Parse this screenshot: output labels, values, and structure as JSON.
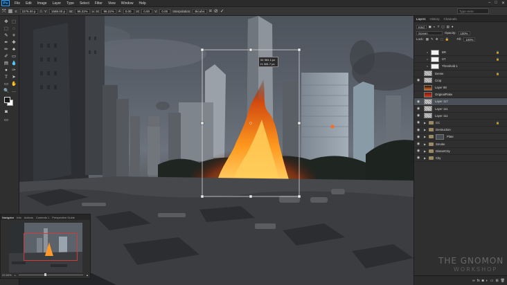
{
  "app": {
    "logo": "Ps"
  },
  "menu": [
    "File",
    "Edit",
    "Image",
    "Layer",
    "Type",
    "Select",
    "Filter",
    "View",
    "Window",
    "Help"
  ],
  "window_controls": [
    "–",
    "□",
    "✕"
  ],
  "options": {
    "x_label": "X:",
    "x_value": "2276.00 p",
    "y_label": "Y:",
    "y_value": "1588.00 p",
    "w_label": "W:",
    "w_value": "98.22%",
    "h_label": "H:",
    "h_value": "98.22%",
    "rot_value": "0.00",
    "hskew_label": "H:",
    "hskew_value": "0.00",
    "vskew_label": "V:",
    "vskew_value": "0.00",
    "interp_label": "Interpolation:",
    "interp_value": "Bicubic",
    "search_placeholder": "Type Here"
  },
  "transform_tooltip": {
    "w": "W: 981.1 px",
    "h": "H: 981.7 px"
  },
  "navigator": {
    "tabs": [
      "Navigator",
      "Info",
      "Actions",
      "Contents 1",
      "Perspective Guide"
    ],
    "zoom": "22.50%"
  },
  "panel": {
    "tabs": [
      "Layers",
      "History",
      "Channels"
    ],
    "kind": "Kind",
    "blend_mode": "Screen",
    "opacity_label": "Opacity:",
    "opacity_value": "100%",
    "lock_label": "Lock:",
    "fill_label": "Fill:",
    "fill_value": "100%"
  },
  "layers": [
    {
      "name": "BR",
      "type": "adjust",
      "eye": false,
      "indent": 1,
      "lock": true
    },
    {
      "name": "ST",
      "type": "adjust",
      "eye": false,
      "indent": 1,
      "lock": true
    },
    {
      "name": "Threshold 1",
      "type": "adjust",
      "eye": false,
      "indent": 1,
      "lock": false
    },
    {
      "name": "Dense",
      "type": "noise",
      "eye": false,
      "indent": 0,
      "lock": true
    },
    {
      "name": "Crop",
      "type": "noise",
      "eye": true,
      "indent": 0,
      "lock": false
    },
    {
      "name": "Layer 88",
      "type": "fire",
      "eye": false,
      "indent": 0,
      "lock": false
    },
    {
      "name": "OriginalFlake",
      "type": "fire-red",
      "eye": false,
      "indent": 0,
      "lock": false
    },
    {
      "name": "Layer 117",
      "type": "noise",
      "eye": true,
      "indent": 0,
      "lock": false,
      "selected": true
    },
    {
      "name": "Layer 111",
      "type": "noise",
      "eye": true,
      "indent": 0,
      "lock": false
    },
    {
      "name": "Layer 111",
      "type": "noise",
      "eye": true,
      "indent": 0,
      "lock": false
    },
    {
      "name": "CC",
      "type": "folder",
      "eye": true,
      "indent": 0,
      "lock": true
    },
    {
      "name": "Destruction",
      "type": "folder",
      "eye": true,
      "indent": 0,
      "lock": false
    },
    {
      "name": "Plate",
      "type": "folder-thumb",
      "eye": true,
      "indent": 0,
      "lock": false
    },
    {
      "name": "Smoke",
      "type": "folder",
      "eye": true,
      "indent": 0,
      "lock": false
    },
    {
      "name": "DistantCity",
      "type": "folder",
      "eye": true,
      "indent": 0,
      "lock": false
    },
    {
      "name": "City",
      "type": "folder",
      "eye": true,
      "indent": 0,
      "lock": false
    }
  ],
  "panel_bottom_icons": [
    "link-icon",
    "fx-icon",
    "mask-icon",
    "adjustment-icon",
    "folder-icon",
    "new-layer-icon",
    "trash-icon"
  ],
  "watermark": {
    "title": "THE GNOMON",
    "sub": "WORKSHOP"
  }
}
